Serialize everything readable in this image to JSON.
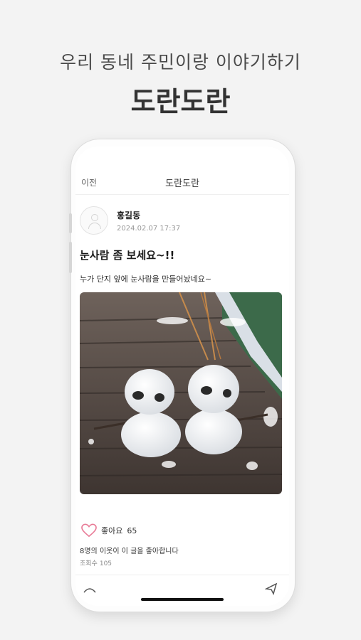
{
  "promo": {
    "subtitle": "우리 동네 주민이랑 이야기하기",
    "title": "도란도란"
  },
  "nav": {
    "back_label": "이전",
    "title": "도란도란"
  },
  "post": {
    "author": "홍길동",
    "date": "2024.02.07 17:37",
    "title": "눈사람 좀 보세요~!!",
    "body": "누가 단지 앞에 눈사람을 만들어놨네요~",
    "image_description_icon": "snowmen-photo",
    "like_label": "좋아요",
    "like_count": "65",
    "like_summary": "8명의 이웃이 이 글을 좋아합니다",
    "views_label": "조회수",
    "views_count": "105"
  },
  "colors": {
    "background": "#f3f3f3",
    "heart": "#e87a96",
    "text": "#222222"
  },
  "icons": {
    "back": "back-label",
    "heart": "heart-outline-icon",
    "avatar": "default-avatar-icon",
    "send": "send-icon",
    "camera": "image-icon"
  }
}
